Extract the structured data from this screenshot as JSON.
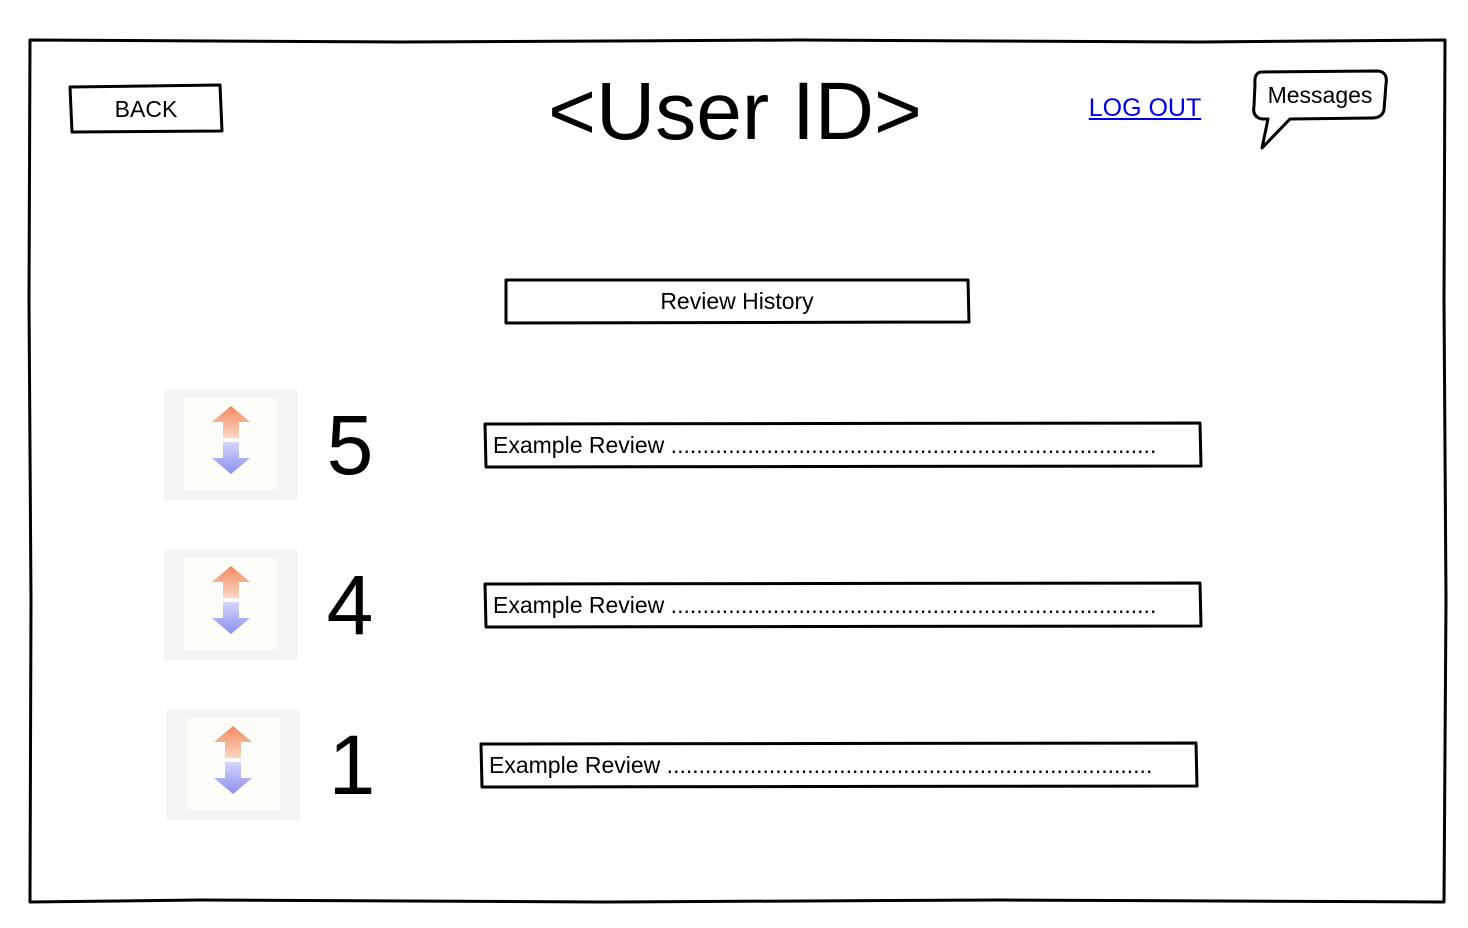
{
  "header": {
    "back_label": "BACK",
    "title": "<User ID>",
    "logout_label": "LOG OUT",
    "messages_label": "Messages"
  },
  "section": {
    "title": "Review History"
  },
  "reviews": [
    {
      "score": "5",
      "text": "Example Review ............................................................................"
    },
    {
      "score": "4",
      "text": "Example Review ............................................................................"
    },
    {
      "score": "1",
      "text": "Example Review ............................................................................"
    }
  ],
  "icons": {
    "vote_up": "arrow-up-icon",
    "vote_down": "arrow-down-icon"
  },
  "colors": {
    "link": "#0000ee",
    "upvote": "#f08a5d",
    "downvote": "#8c8cf0"
  }
}
